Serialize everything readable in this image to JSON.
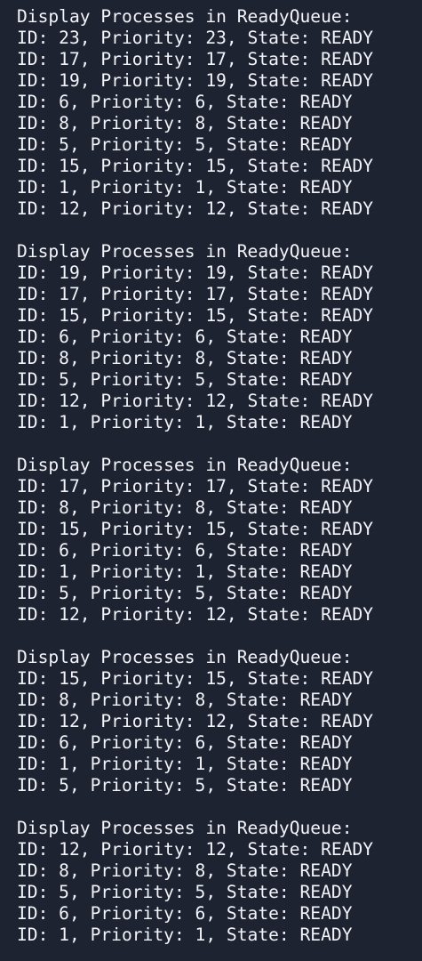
{
  "terminal": {
    "background": "#1e2332",
    "text_color": "#f2f4f8",
    "blocks": [
      {
        "header": "Display Processes in ReadyQueue:",
        "lines": [
          "ID: 23, Priority: 23, State: READY",
          "ID: 17, Priority: 17, State: READY",
          "ID: 19, Priority: 19, State: READY",
          "ID: 6, Priority: 6, State: READY",
          "ID: 8, Priority: 8, State: READY",
          "ID: 5, Priority: 5, State: READY",
          "ID: 15, Priority: 15, State: READY",
          "ID: 1, Priority: 1, State: READY",
          "ID: 12, Priority: 12, State: READY"
        ]
      },
      {
        "header": "Display Processes in ReadyQueue:",
        "lines": [
          "ID: 19, Priority: 19, State: READY",
          "ID: 17, Priority: 17, State: READY",
          "ID: 15, Priority: 15, State: READY",
          "ID: 6, Priority: 6, State: READY",
          "ID: 8, Priority: 8, State: READY",
          "ID: 5, Priority: 5, State: READY",
          "ID: 12, Priority: 12, State: READY",
          "ID: 1, Priority: 1, State: READY"
        ]
      },
      {
        "header": "Display Processes in ReadyQueue:",
        "lines": [
          "ID: 17, Priority: 17, State: READY",
          "ID: 8, Priority: 8, State: READY",
          "ID: 15, Priority: 15, State: READY",
          "ID: 6, Priority: 6, State: READY",
          "ID: 1, Priority: 1, State: READY",
          "ID: 5, Priority: 5, State: READY",
          "ID: 12, Priority: 12, State: READY"
        ]
      },
      {
        "header": "Display Processes in ReadyQueue:",
        "lines": [
          "ID: 15, Priority: 15, State: READY",
          "ID: 8, Priority: 8, State: READY",
          "ID: 12, Priority: 12, State: READY",
          "ID: 6, Priority: 6, State: READY",
          "ID: 1, Priority: 1, State: READY",
          "ID: 5, Priority: 5, State: READY"
        ]
      },
      {
        "header": "Display Processes in ReadyQueue:",
        "lines": [
          "ID: 12, Priority: 12, State: READY",
          "ID: 8, Priority: 8, State: READY",
          "ID: 5, Priority: 5, State: READY",
          "ID: 6, Priority: 6, State: READY",
          "ID: 1, Priority: 1, State: READY"
        ]
      }
    ]
  }
}
